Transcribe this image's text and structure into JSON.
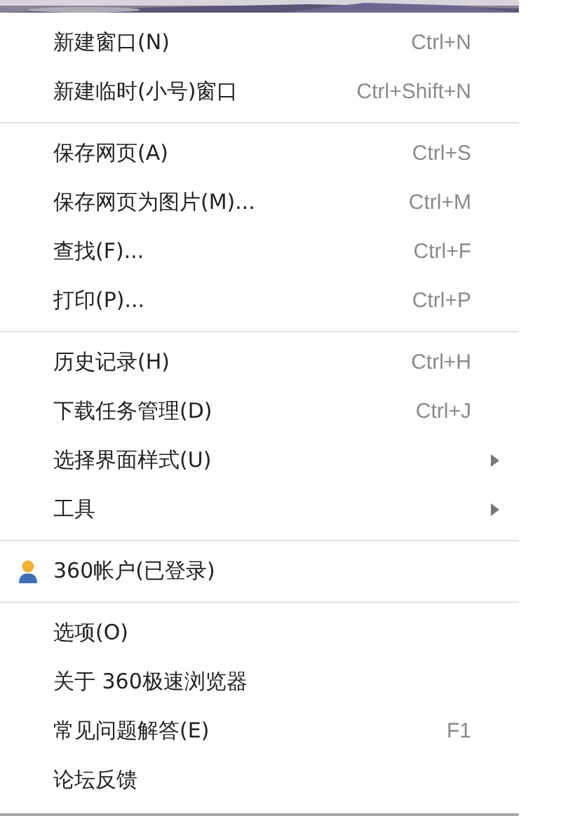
{
  "menu": {
    "groups": [
      {
        "items": [
          {
            "kind": "plain",
            "label": "新建窗口(N)",
            "shortcut": "Ctrl+N",
            "submenu": false
          },
          {
            "kind": "plain",
            "label": "新建临时(小号)窗口",
            "shortcut": "Ctrl+Shift+N",
            "submenu": false
          }
        ]
      },
      {
        "items": [
          {
            "kind": "plain",
            "label": "保存网页(A)",
            "shortcut": "Ctrl+S",
            "submenu": false
          },
          {
            "kind": "plain",
            "label": "保存网页为图片(M)...",
            "shortcut": "Ctrl+M",
            "submenu": false
          },
          {
            "kind": "plain",
            "label": "查找(F)...",
            "shortcut": "Ctrl+F",
            "submenu": false
          },
          {
            "kind": "plain",
            "label": "打印(P)...",
            "shortcut": "Ctrl+P",
            "submenu": false
          }
        ]
      },
      {
        "items": [
          {
            "kind": "plain",
            "label": "历史记录(H)",
            "shortcut": "Ctrl+H",
            "submenu": false
          },
          {
            "kind": "plain",
            "label": "下载任务管理(D)",
            "shortcut": "Ctrl+J",
            "submenu": false
          },
          {
            "kind": "plain",
            "label": "选择界面样式(U)",
            "submenu": true
          },
          {
            "kind": "plain",
            "label": "工具",
            "submenu": true
          }
        ]
      },
      {
        "items": [
          {
            "kind": "account",
            "label": "360帐户(已登录)",
            "submenu": false
          }
        ]
      },
      {
        "items": [
          {
            "kind": "plain",
            "label": "选项(O)",
            "submenu": false
          },
          {
            "kind": "plain",
            "label": "关于 360极速浏览器",
            "submenu": false
          },
          {
            "kind": "plain",
            "label": "常见问题解答(E)",
            "shortcut": "F1",
            "submenu": false
          },
          {
            "kind": "plain",
            "label": "论坛反馈",
            "submenu": false
          }
        ]
      }
    ]
  }
}
